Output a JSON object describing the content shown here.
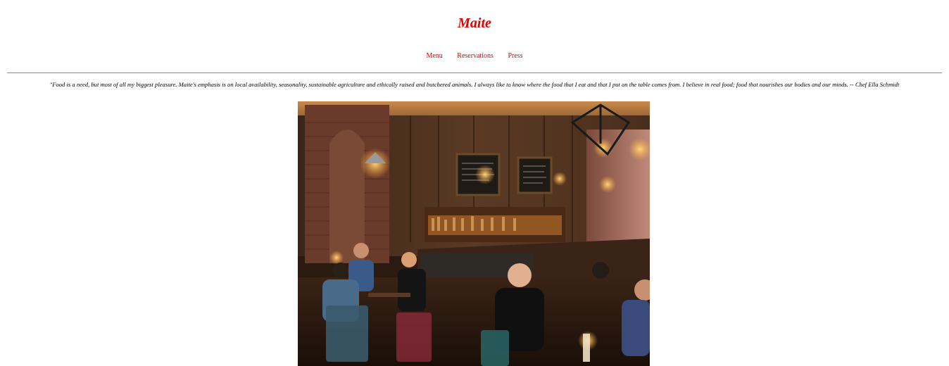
{
  "header": {
    "title": "Maite"
  },
  "nav": {
    "items": [
      {
        "label": "Menu"
      },
      {
        "label": "Reservations"
      },
      {
        "label": "Press"
      }
    ]
  },
  "intro": {
    "quote": "\"Food is a need, but most of all my biggest pleasure. Maite's emphasis is on local availability, seasonality, sustainable agriculture and ethically raised and butchered animals. I always like to know where the food that I eat and that I put on the table comes from. I believe in real food; food that nourishes our bodies and our minds. -- Chef Ella Schmidt"
  },
  "colors": {
    "accent": "#e00000",
    "divider": "#8a8a8a"
  }
}
